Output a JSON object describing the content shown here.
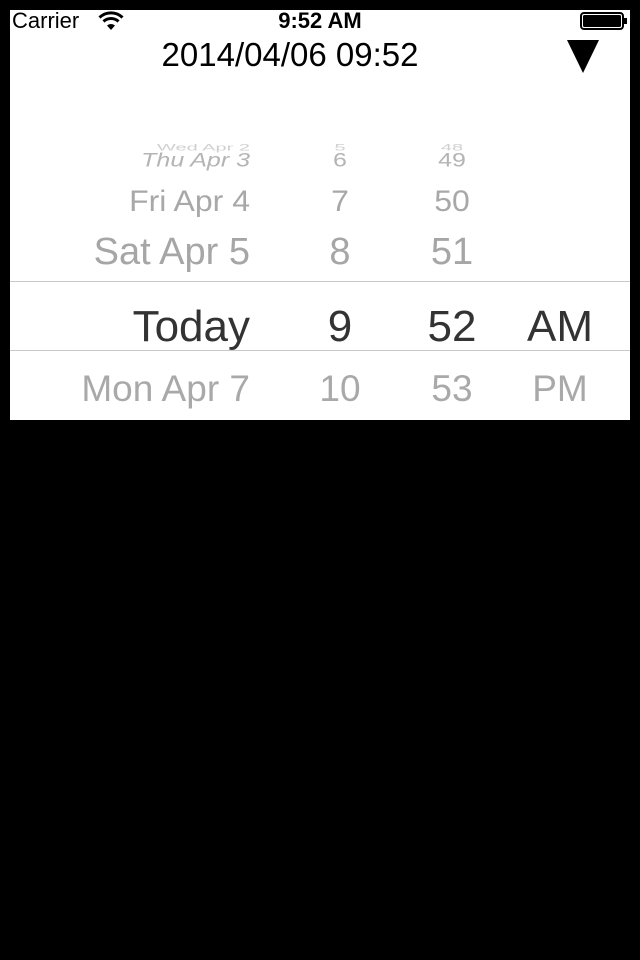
{
  "status_bar": {
    "carrier": "Carrier",
    "time": "9:52 AM",
    "wifi_icon": "wifi-icon",
    "battery_icon": "battery-icon"
  },
  "header": {
    "title": "2014/04/06 09:52",
    "toggle_icon": "triangle-down-icon"
  },
  "picker": {
    "dates": [
      "Wed Apr 2",
      "Thu Apr 3",
      "Fri Apr 4",
      "Sat Apr 5",
      "Today",
      "Mon Apr 7"
    ],
    "hours": [
      "5",
      "6",
      "7",
      "8",
      "9",
      "10"
    ],
    "minutes": [
      "48",
      "49",
      "50",
      "51",
      "52",
      "53"
    ],
    "ampm": [
      "AM",
      "PM"
    ],
    "selected": {
      "date": "Today",
      "hour": "9",
      "minute": "52",
      "ampm": "AM"
    }
  },
  "colors": {
    "background": "#000000",
    "panel": "#ffffff",
    "selected_text": "#333333",
    "unselected_text": "#a8a8a8",
    "selection_line": "#c8c8cc"
  }
}
